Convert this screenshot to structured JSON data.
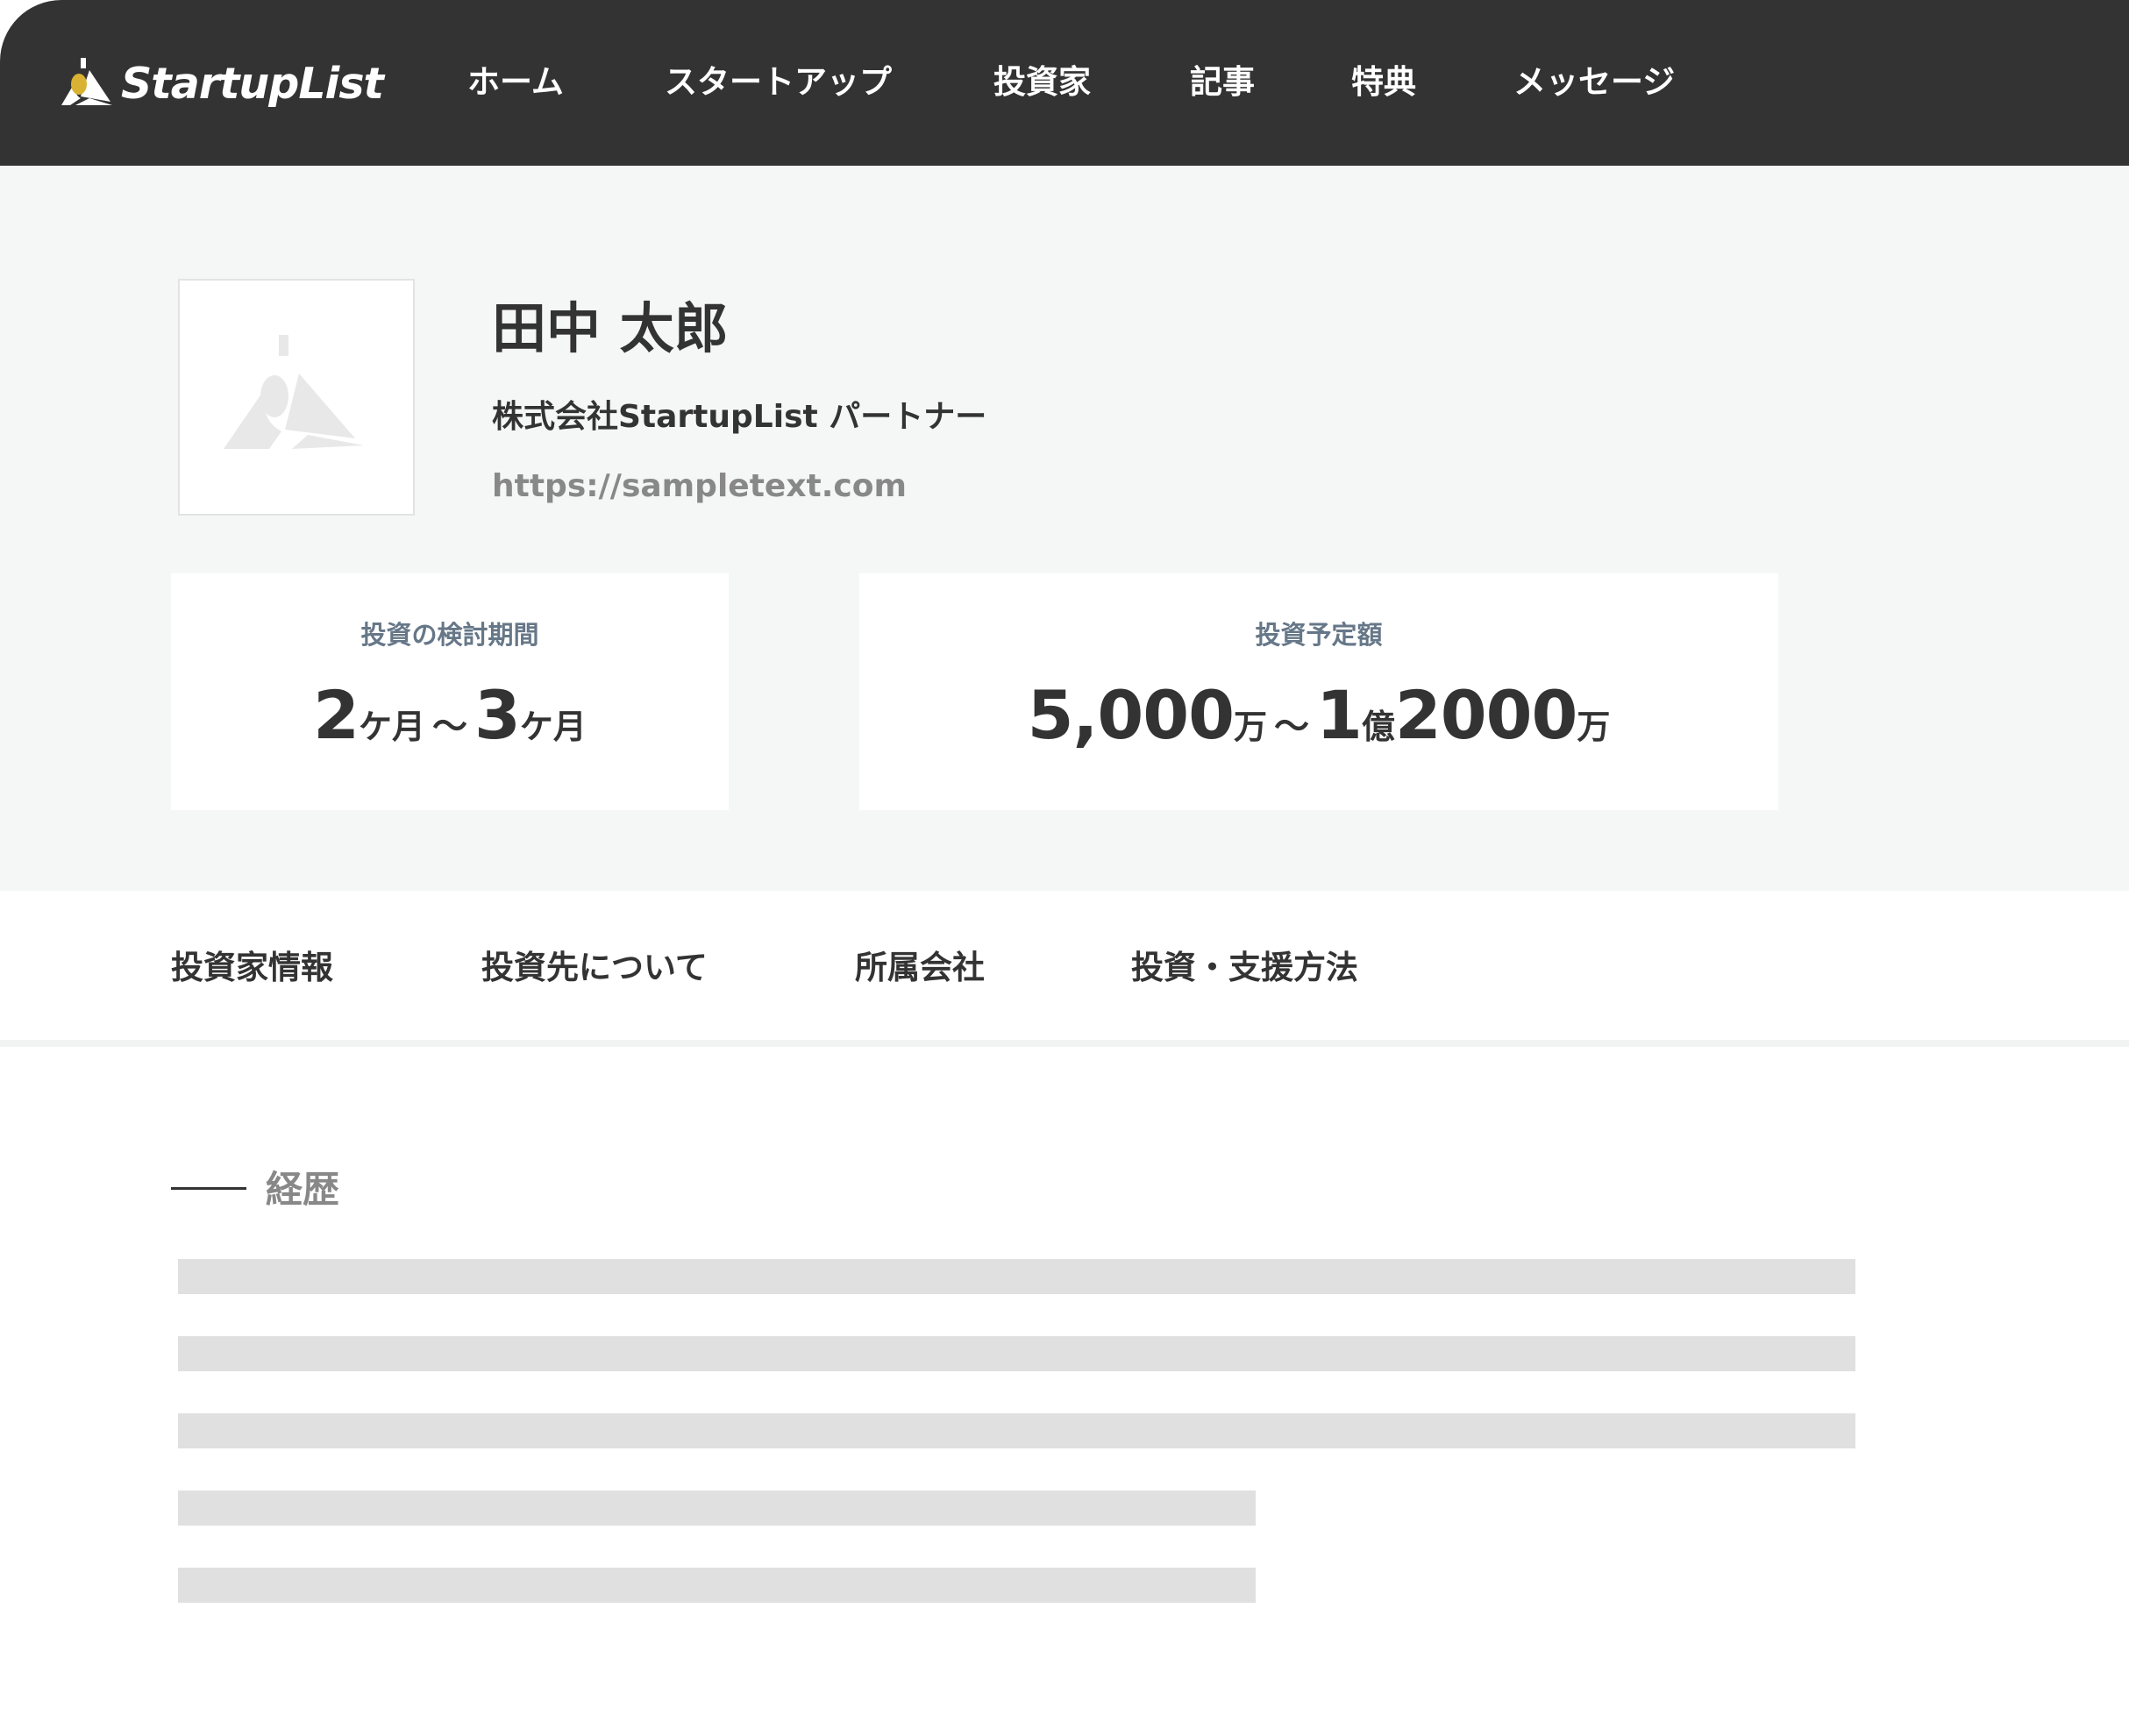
{
  "header": {
    "logo_text": "StartupList",
    "nav": [
      "ホーム",
      "スタートアップ",
      "投資家",
      "記事",
      "特典",
      "メッセージ"
    ]
  },
  "profile": {
    "name": "田中 太郎",
    "position": "株式会社StartupList パートナー",
    "url": "https://sampletext.com"
  },
  "period_card": {
    "label": "投資の検討期間",
    "min_num": "2",
    "min_unit": "ケ月",
    "tilde": "〜",
    "max_num": "3",
    "max_unit": "ケ月"
  },
  "amount_card": {
    "label": "投資予定額",
    "min_num": "5,000",
    "min_unit": "万",
    "tilde": "〜",
    "max_num1": "1",
    "max_unit1": "億",
    "max_num2": "2000",
    "max_unit2": "万"
  },
  "tabs": [
    "投資家情報",
    "投資先について",
    "所属会社",
    "投資・支援方法"
  ],
  "section": {
    "title": "経歴"
  },
  "colors": {
    "header_bg": "#333333",
    "hero_bg": "#f5f7f6",
    "placeholder_bar": "#e0e0e0",
    "card_label": "#667788"
  }
}
